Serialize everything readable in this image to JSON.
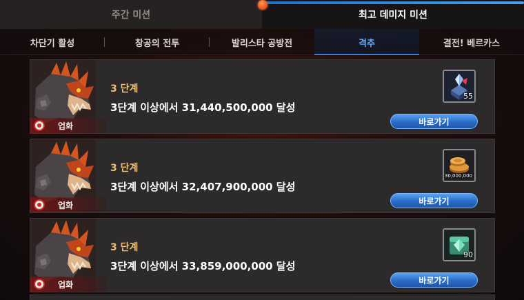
{
  "top_tabs": [
    {
      "label": "주간 미션",
      "active": false
    },
    {
      "label": "최고 데미지 미션",
      "active": true
    }
  ],
  "sub_tabs": [
    {
      "label": "차단기 활성",
      "active": false
    },
    {
      "label": "창공의 전투",
      "active": false
    },
    {
      "label": "발리스타 공방전",
      "active": false
    },
    {
      "label": "격추",
      "active": true
    },
    {
      "label": "결전! 베르카스",
      "active": false
    }
  ],
  "missions": [
    {
      "boss_name": "업화",
      "stage": "3 단계",
      "description": "3단계 이상에서 31,440,500,000 달성",
      "reward_icon": "crystal-box-icon",
      "reward_qty": "55",
      "button_label": "바로가기"
    },
    {
      "boss_name": "업화",
      "stage": "3 단계",
      "description": "3단계 이상에서 32,407,900,000 달성",
      "reward_icon": "gold-coins-icon",
      "reward_qty": "30,000,000",
      "button_label": "바로가기"
    },
    {
      "boss_name": "업화",
      "stage": "3 단계",
      "description": "3단계 이상에서 33,859,000,000 달성",
      "reward_icon": "green-gem-box-icon",
      "reward_qty": "90",
      "button_label": "바로가기"
    }
  ],
  "colors": {
    "accent_blue": "#3c7ed6",
    "stage_gold": "#f0c070",
    "knob_orange": "#ec4a12"
  }
}
